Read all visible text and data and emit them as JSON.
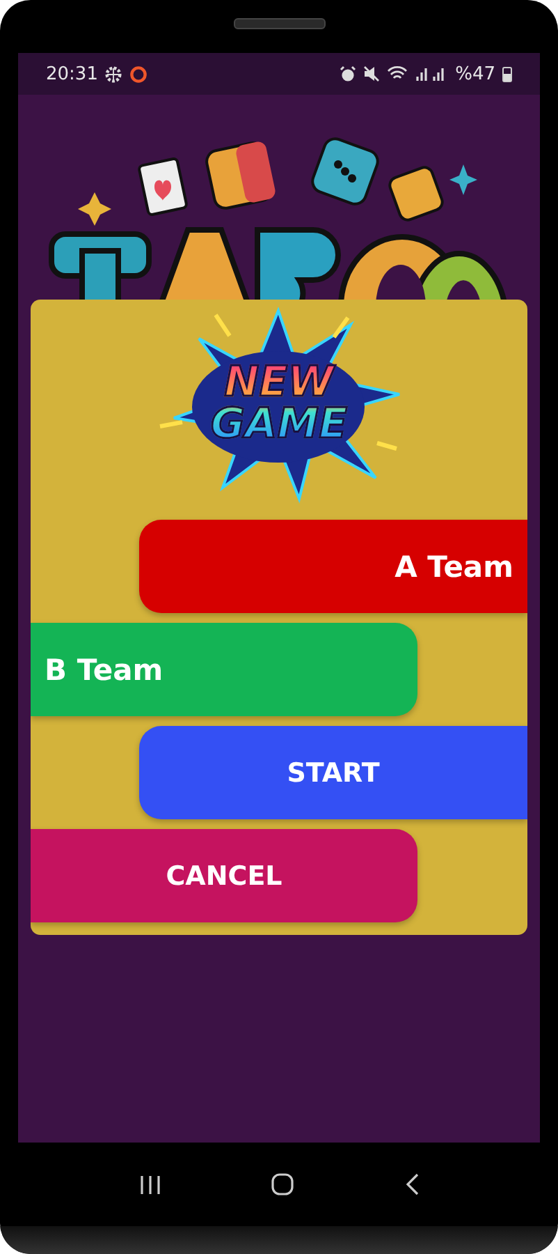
{
  "status_bar": {
    "time": "20:31",
    "battery": "%47"
  },
  "dialog": {
    "logo": "NEW GAME",
    "buttons": [
      {
        "label": "A Team",
        "kind": "team",
        "color": "#d60000"
      },
      {
        "label": "B Team",
        "kind": "team",
        "color": "#14b455"
      },
      {
        "label": "START",
        "kind": "action",
        "color": "#3450f4"
      },
      {
        "label": "CANCEL",
        "kind": "action",
        "color": "#c5135f"
      }
    ]
  }
}
